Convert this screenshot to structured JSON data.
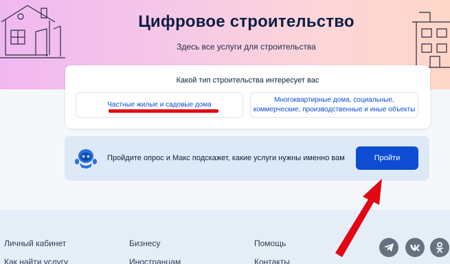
{
  "hero": {
    "title": "Цифровое строительство",
    "subtitle": "Здесь все услуги для строительства",
    "gradient_start": "#f0b8f1",
    "gradient_end": "#ffd6c8"
  },
  "card": {
    "title": "Какой тип строительства интересует вас",
    "options": [
      {
        "label": "Частные жилые и садовые дома"
      },
      {
        "label_line1": "Многоквартирные дома, социальные,",
        "label_line2": "коммерческие, производственные и иные объекты"
      }
    ]
  },
  "survey": {
    "text": "Пройдите опрос и Макс подскажет, какие услуги нужны именно вам",
    "button_label": "Пройти",
    "button_color": "#0d4cd3"
  },
  "footer": {
    "columns": [
      [
        "Личный кабинет",
        "Как найти услугу"
      ],
      [
        "Бизнесу",
        "Иностранцам"
      ],
      [
        "Помощь",
        "Контакты"
      ]
    ],
    "social_icons": [
      "telegram-icon",
      "vk-icon",
      "odnoklassniki-icon"
    ]
  },
  "annotation": {
    "color": "#e30613"
  }
}
